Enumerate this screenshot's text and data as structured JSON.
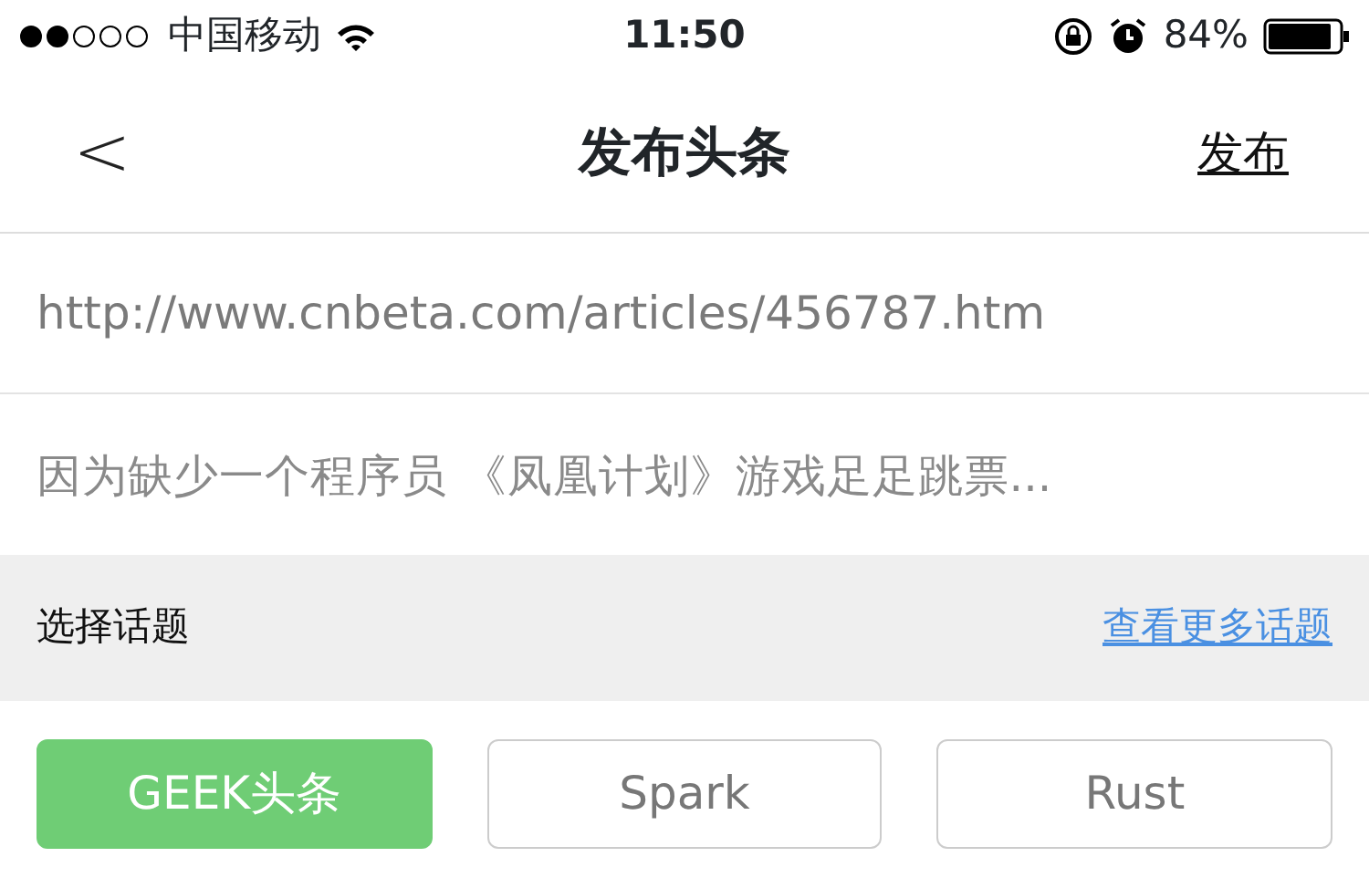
{
  "status_bar": {
    "carrier": "中国移动",
    "time": "11:50",
    "battery": "84%"
  },
  "nav": {
    "back": "<",
    "title": "发布头条",
    "action": "发布"
  },
  "fields": [
    {
      "value": "http://www.cnbeta.com/articles/456787.htm"
    },
    {
      "value": "因为缺少一个程序员 《凤凰计划》游戏足足跳票..."
    }
  ],
  "topics_header": {
    "label": "选择话题",
    "link": "查看更多话题"
  },
  "topics": [
    {
      "label": "GEEK头条",
      "selected": true
    },
    {
      "label": "Spark",
      "selected": false
    },
    {
      "label": "Rust",
      "selected": false
    }
  ]
}
